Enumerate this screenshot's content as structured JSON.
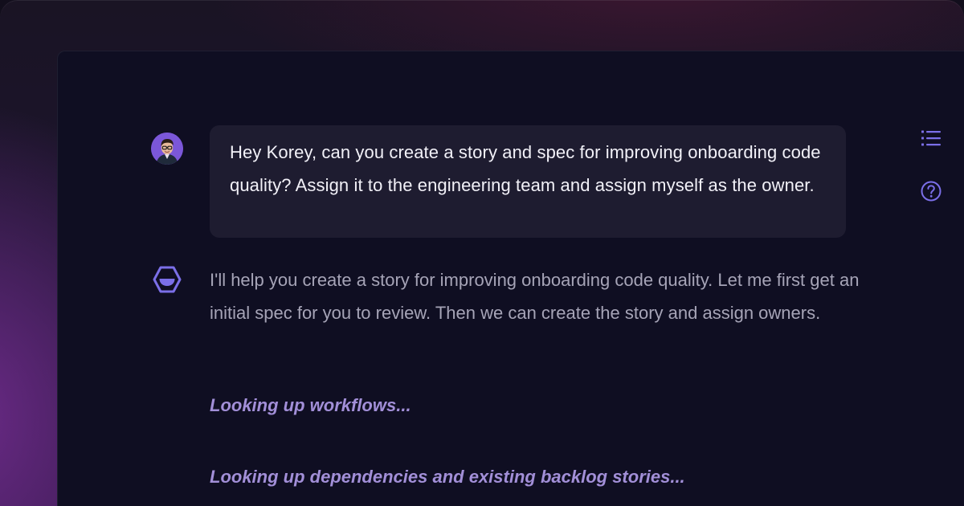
{
  "conversation": {
    "user_message": "Hey Korey, can you create a story and spec for improving onboarding code quality? Assign it to the engineering team and assign myself as the owner.",
    "assistant_message": "I'll help you create a story for improving onboarding code quality. Let me first get an initial spec for you to review. Then we can create the story and assign owners.",
    "status_lines": [
      "Looking up workflows...",
      "Looking up dependencies and existing backlog stories..."
    ]
  },
  "icons": {
    "user_avatar": "user-avatar",
    "assistant_logo": "hexagon-logo-icon",
    "side_list": "list-icon",
    "side_help": "help-circle-icon"
  },
  "colors": {
    "accent": "#7b6fe8",
    "status_text": "#a28fd8",
    "window_bg": "#0f0e22",
    "bubble_bg": "#1e1c30"
  }
}
